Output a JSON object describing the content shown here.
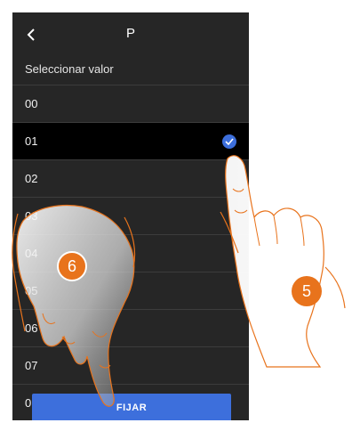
{
  "header": {
    "title": "P",
    "back_icon": "chevron-left-icon"
  },
  "subtitle": "Seleccionar valor",
  "values": [
    {
      "label": "00",
      "selected": false
    },
    {
      "label": "01",
      "selected": true
    },
    {
      "label": "02",
      "selected": false
    },
    {
      "label": "03",
      "selected": false
    },
    {
      "label": "04",
      "selected": false
    },
    {
      "label": "05",
      "selected": false
    },
    {
      "label": "06",
      "selected": false
    },
    {
      "label": "07",
      "selected": false
    },
    {
      "label": "0",
      "selected": false
    }
  ],
  "fijar_label": "FIJAR",
  "steps": {
    "first": "5",
    "second": "6"
  },
  "colors": {
    "accent": "#3d6fdc",
    "screen_bg": "#262626",
    "selected_bg": "#000000",
    "step_badge": "#e8731c"
  }
}
